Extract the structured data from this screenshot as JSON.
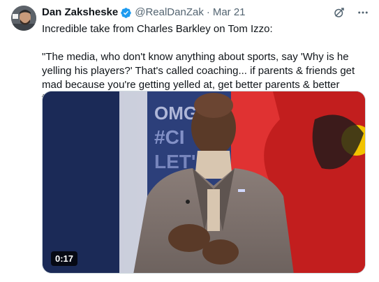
{
  "author": {
    "display_name": "Dan Zaksheske",
    "handle": "@RealDanZak",
    "separator": "·",
    "date": "Mar 21",
    "verified": true,
    "avatar_icon": "avatar-photo"
  },
  "tweet": {
    "text": "Incredible take from Charles Barkley on Tom Izzo:\n\n\"The media, who don't know anything about sports, say 'Why is he yelling his players?' That's called coaching... if parents & friends get mad because you're getting yelled at, get better parents & better friends.\""
  },
  "media": {
    "type": "video",
    "duration": "0:17"
  },
  "icons": {
    "grok": "grok-icon",
    "more": "more-icon",
    "verified": "verified-badge-icon"
  },
  "colors": {
    "verified_blue": "#1d9bf0",
    "secondary_text": "#536471",
    "primary_text": "#0f1419"
  }
}
